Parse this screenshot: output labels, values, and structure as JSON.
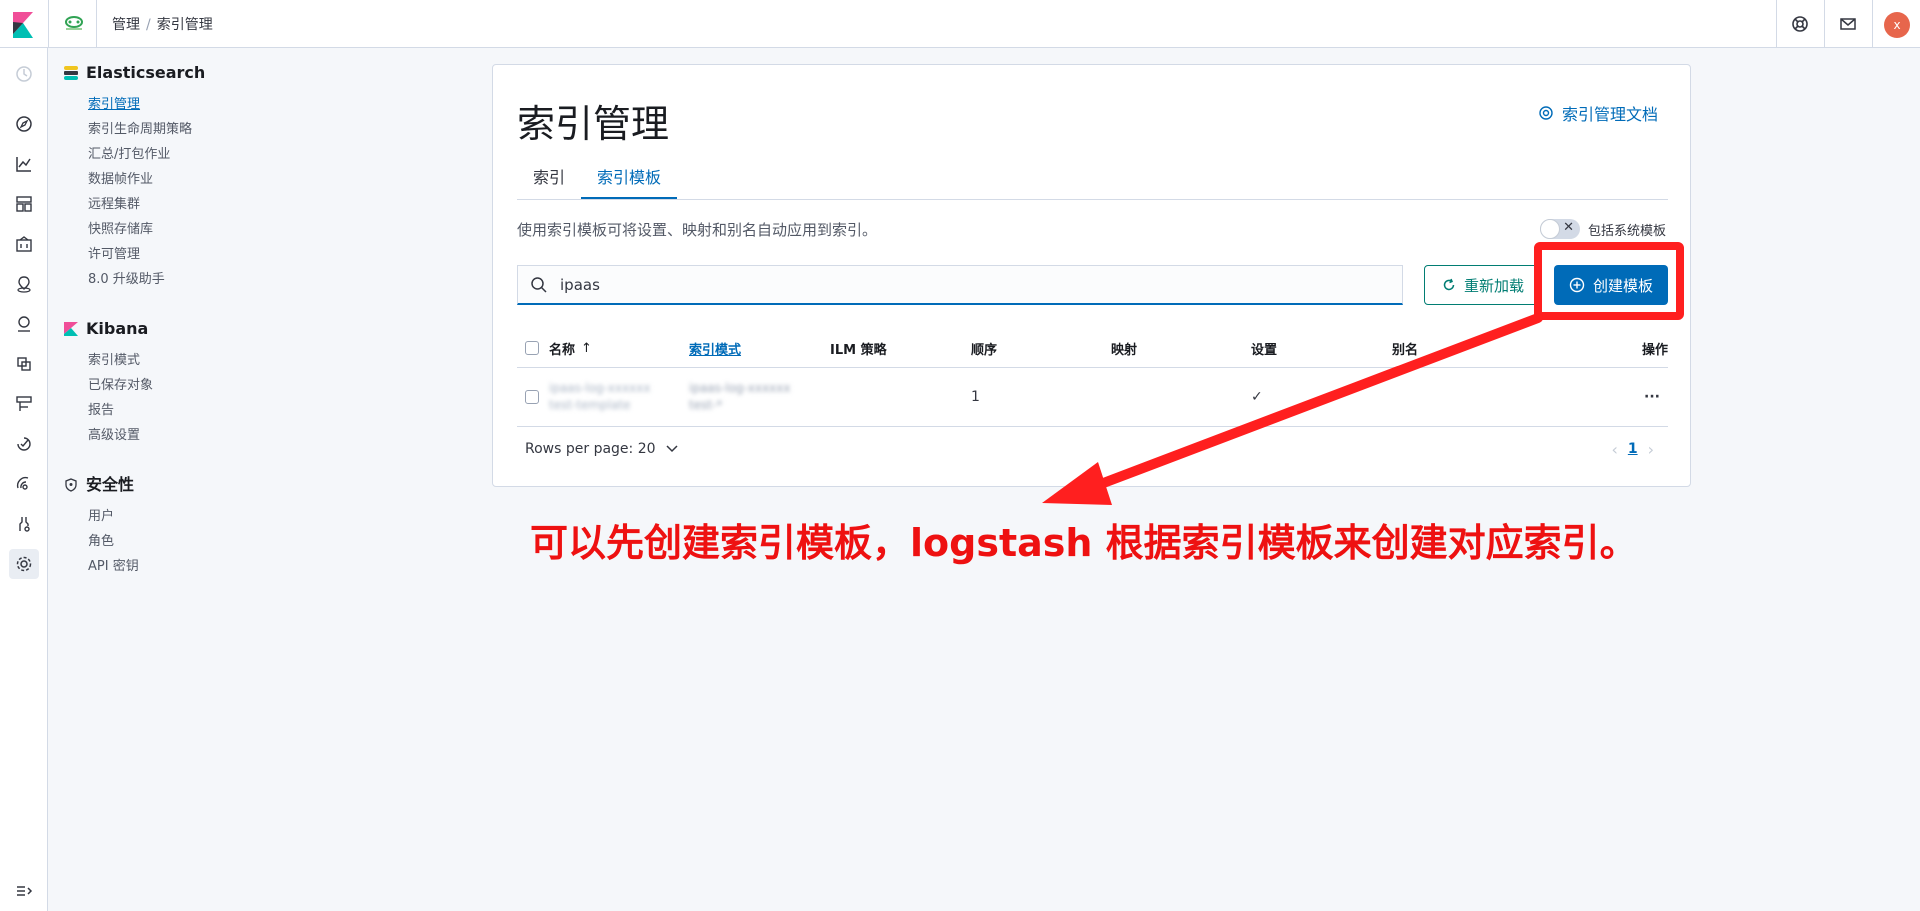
{
  "header": {
    "breadcrumbs": [
      "管理",
      "索引管理"
    ],
    "avatar_initial": "x"
  },
  "sidenav": {
    "sections": [
      {
        "title": "Elasticsearch",
        "items": [
          "索引管理",
          "索引生命周期策略",
          "汇总/打包作业",
          "数据帧作业",
          "远程集群",
          "快照存储库",
          "许可管理",
          "8.0 升级助手"
        ]
      },
      {
        "title": "Kibana",
        "items": [
          "索引模式",
          "已保存对象",
          "报告",
          "高级设置"
        ]
      },
      {
        "title": "安全性",
        "items": [
          "用户",
          "角色",
          "API 密钥"
        ]
      }
    ],
    "active_item": "索引管理"
  },
  "main": {
    "title": "索引管理",
    "doc_link": "索引管理文档",
    "tabs": [
      "索引",
      "索引模板"
    ],
    "selected_tab": "索引模板",
    "description": "使用索引模板可将设置、映射和别名自动应用到索引。",
    "include_system_label": "包括系统模板",
    "include_system_on": false,
    "search_value": "ipaas",
    "reload_label": "重新加载",
    "create_label": "创建模板",
    "columns": [
      "名称",
      "索引模式",
      "ILM 策略",
      "顺序",
      "映射",
      "设置",
      "别名",
      "操作"
    ],
    "sorted_column": "名称",
    "rows": [
      {
        "name": [
          "ipaas-log-xxxxxx",
          "test-template"
        ],
        "index_pattern": [
          "ipaas-log-xxxxxx",
          "test-*"
        ],
        "ilm_policy": "",
        "order": "1",
        "mappings": "",
        "settings": "✓",
        "aliases": "",
        "actions": "···"
      }
    ],
    "rows_per_page": "Rows per page: 20",
    "current_page": "1"
  },
  "annotation": {
    "text": "可以先创建索引模板，logstash 根据索引模板来创建对应索引。",
    "color": "#ee1111"
  }
}
